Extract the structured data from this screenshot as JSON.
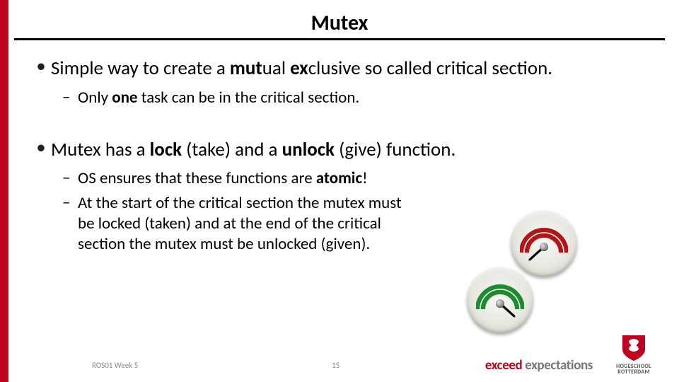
{
  "title": "Mutex",
  "bullets": [
    {
      "pre": "Simple way to create a ",
      "b1": "mut",
      "mid1": "ual ",
      "b2": "ex",
      "post": "clusive so called critical section.",
      "sub": [
        {
          "pre": "Only ",
          "b": "one",
          "post": " task can be in the critical section."
        }
      ]
    },
    {
      "pre": "Mutex has a ",
      "b1": "lock",
      "mid1": " (take) and a ",
      "b2": "unlock",
      "post": " (give) function.",
      "sub": [
        {
          "pre": "OS ensures that these functions are ",
          "b": "atomic",
          "post": "!"
        },
        {
          "full": "At the start of the critical section the mutex must be locked (taken) and at the end of the critical section the mutex must be unlocked (given)."
        }
      ]
    }
  ],
  "footer": "ROS01 Week 5",
  "page": "15",
  "tagline": {
    "exceed": "exceed ",
    "expect": "expectations"
  },
  "logo": {
    "line1": "HOGESCHOOL",
    "line2": "ROTTERDAM"
  },
  "gauge": {
    "red_label": "",
    "green_label": ""
  }
}
